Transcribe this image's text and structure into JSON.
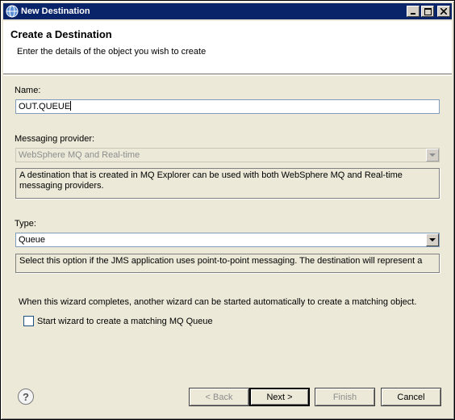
{
  "window": {
    "title": "New Destination"
  },
  "header": {
    "title": "Create a Destination",
    "description": "Enter the details of the object you wish to create"
  },
  "form": {
    "name_label": "Name:",
    "name_value": "OUT.QUEUE",
    "provider_label": "Messaging provider:",
    "provider_value": "WebSphere MQ and Real-time",
    "provider_info": "A destination that is created in MQ Explorer can be used with both WebSphere MQ and Real-time messaging providers.",
    "type_label": "Type:",
    "type_value": "Queue",
    "type_info": "Select this option if the JMS application uses point-to-point messaging. The destination will represent a",
    "wizard_note": "When this wizard completes, another wizard can be started automatically to create a matching object.",
    "checkbox_label": "Start wizard to create a matching MQ Queue",
    "checkbox_checked": false
  },
  "buttons": {
    "back": "< Back",
    "next": "Next >",
    "finish": "Finish",
    "cancel": "Cancel",
    "help": "?"
  },
  "icons": {
    "app": "globe-icon",
    "minimize": "minimize-icon",
    "maximize": "maximize-icon",
    "close": "close-icon",
    "dropdown": "chevron-down-icon",
    "help": "help-icon"
  }
}
